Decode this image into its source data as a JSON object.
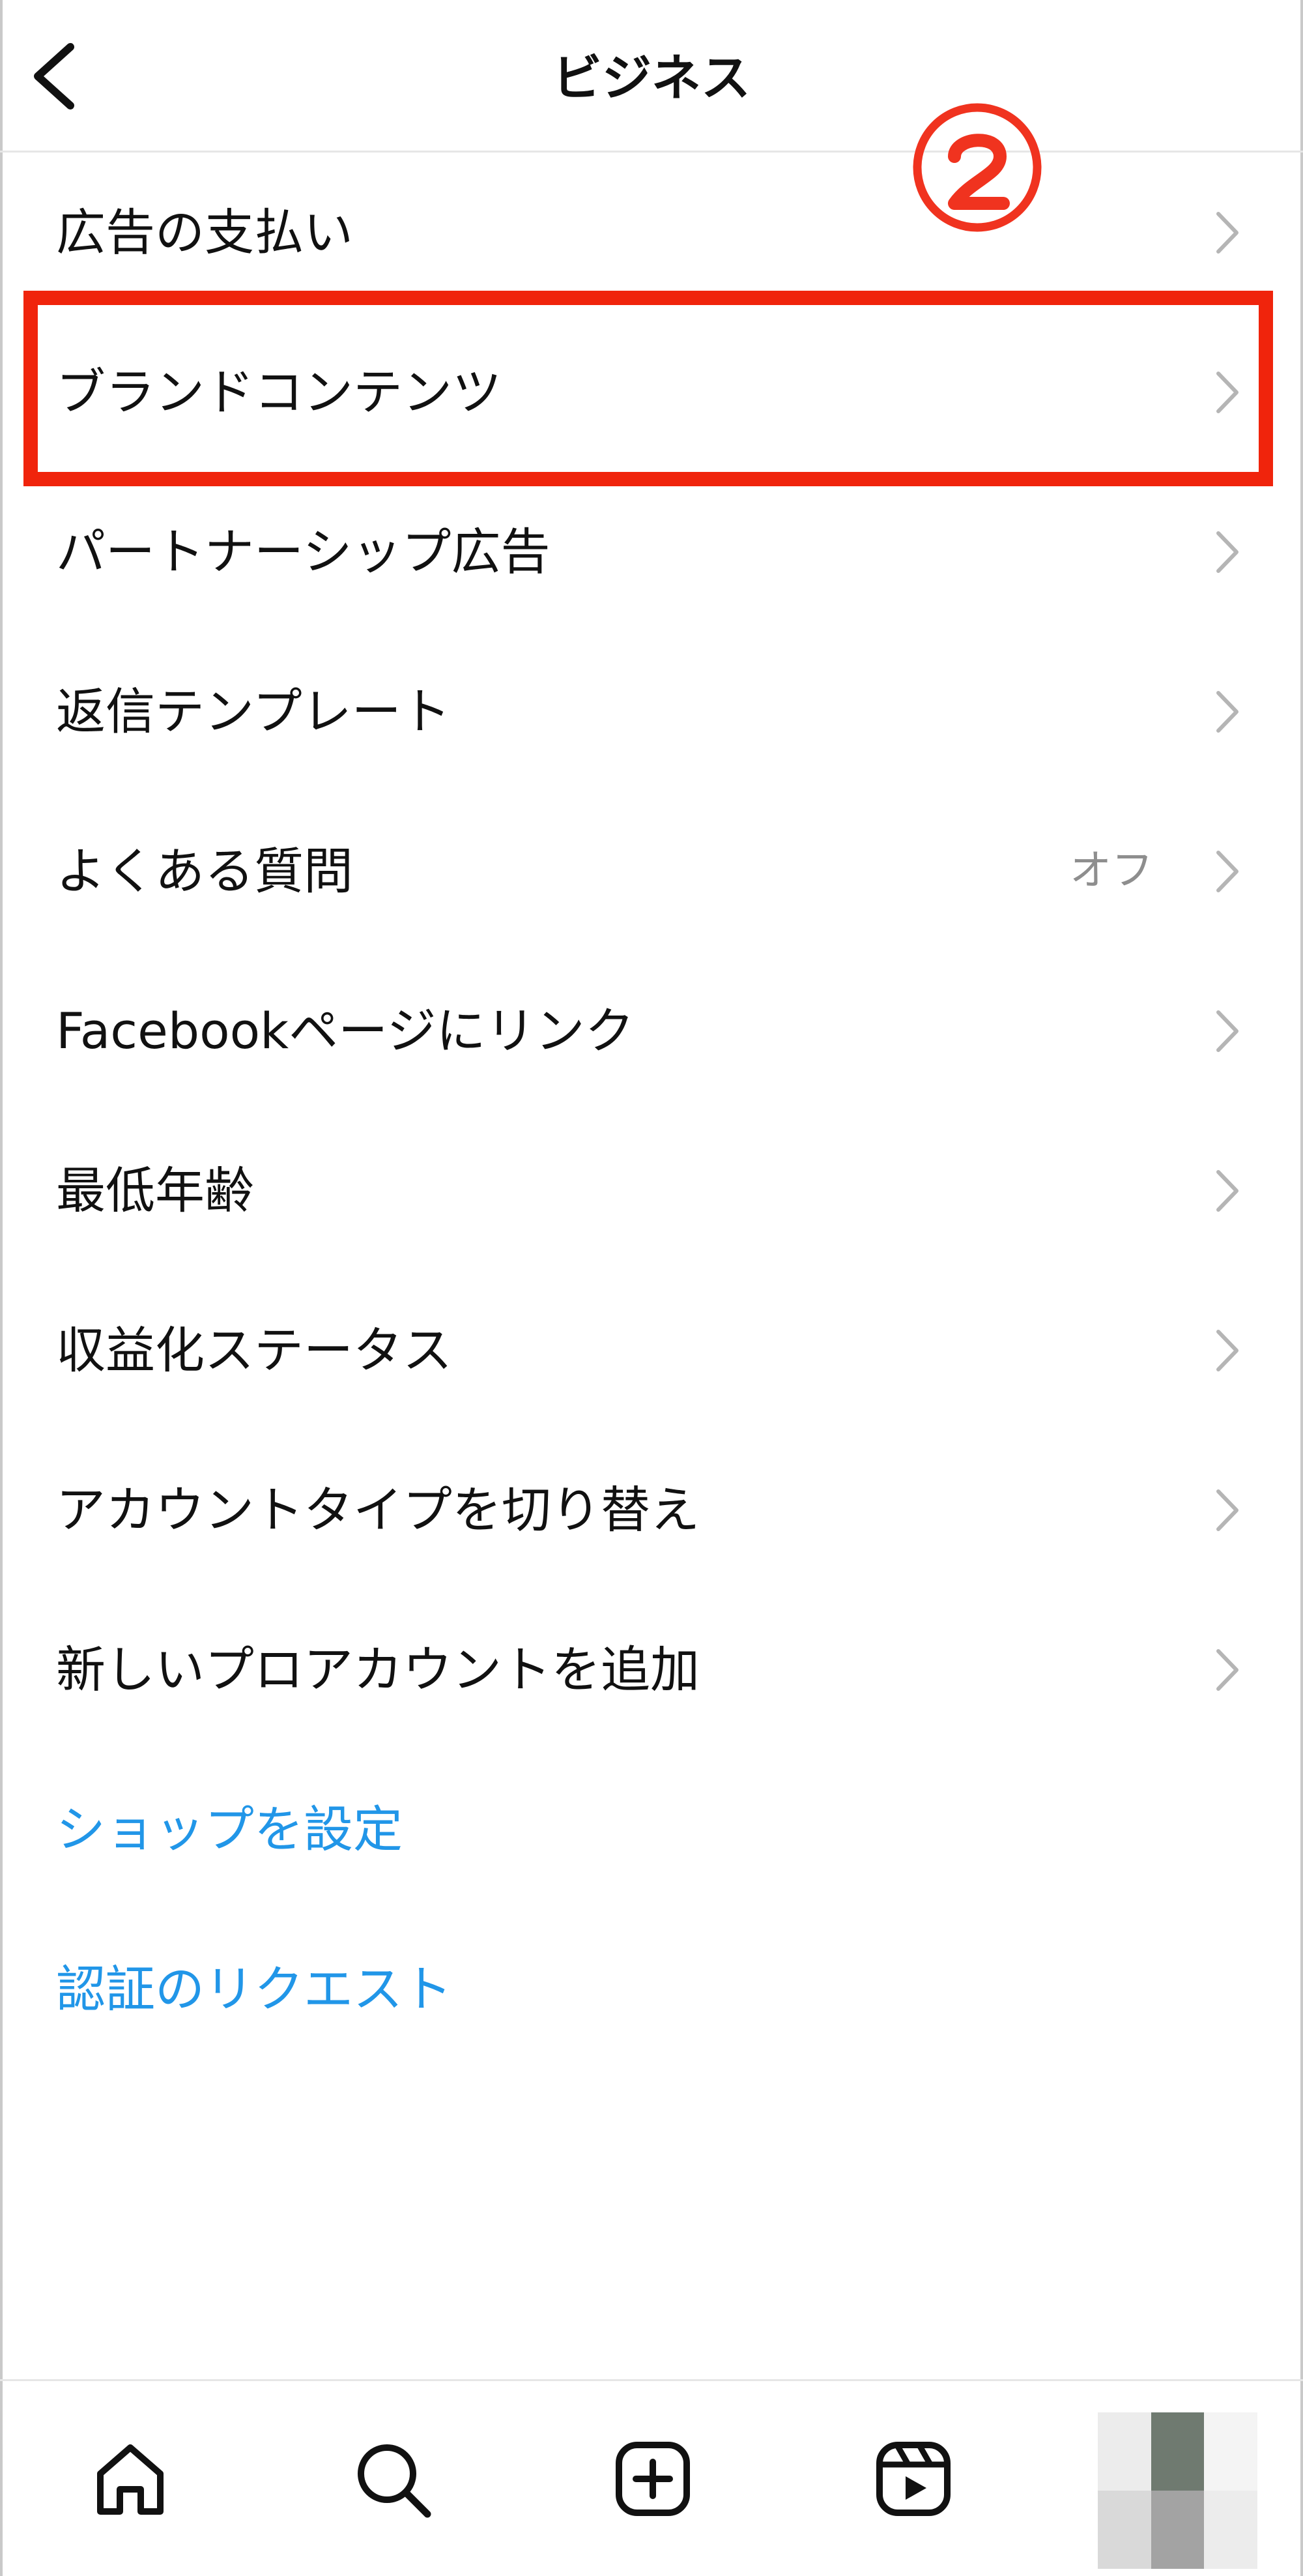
{
  "header": {
    "title": "ビジネス",
    "back_icon": "chevron-left-icon"
  },
  "annotation": {
    "number": "②",
    "highlight_color": "#f0240c"
  },
  "menu": {
    "items": [
      {
        "label": "広告の支払い",
        "value": ""
      },
      {
        "label": "ブランドコンテンツ",
        "value": "",
        "highlighted": true
      },
      {
        "label": "パートナーシップ広告",
        "value": ""
      },
      {
        "label": "返信テンプレート",
        "value": ""
      },
      {
        "label": "よくある質問",
        "value": "オフ"
      },
      {
        "label": "Facebookページにリンク",
        "value": ""
      },
      {
        "label": "最低年齢",
        "value": ""
      },
      {
        "label": "収益化ステータス",
        "value": ""
      },
      {
        "label": "アカウントタイプを切り替え",
        "value": ""
      },
      {
        "label": "新しいプロアカウントを追加",
        "value": ""
      }
    ],
    "links": [
      {
        "label": "ショップを設定"
      },
      {
        "label": "認証のリクエスト"
      }
    ],
    "link_color": "#2196e8"
  },
  "bottom_nav": {
    "items": [
      "home-icon",
      "search-icon",
      "create-post-icon",
      "reels-icon",
      "profile-avatar"
    ]
  }
}
